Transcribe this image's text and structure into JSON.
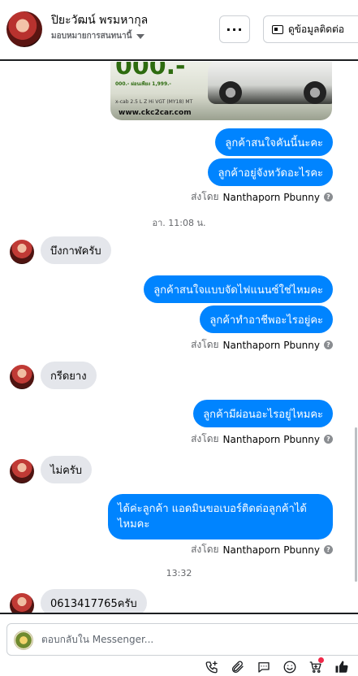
{
  "header": {
    "name": "ปิยะวัฒน์ พรมหากุล",
    "subtitle": "มอบหมายการสนทนานี้",
    "more_label": "···",
    "contact_label": "ดูข้อมูลติดต่อ"
  },
  "ad_image": {
    "headline": "000.-",
    "detail": "000.- ผ่อนเพียง 1,999.-",
    "model": "x-cab 2.5 L Z Hi VGT (MY18) MT",
    "url": "www.ckc2car.com"
  },
  "messages": {
    "out1": "ลูกค้าสนใจคันนี้นะคะ",
    "out2": "ลูกค้าอยู่จังหวัดอะไรคะ",
    "time1": "อา. 11:08 น.",
    "in1": "บึงกาฬครับ",
    "out3": "ลูกค้าสนใจแบบจัดไฟแนนซ์ใช่ไหมคะ",
    "out4": "ลูกค้าทำอาชีพอะไรอยู่คะ",
    "in2": "กรีดยาง",
    "out5": "ลูกค้ามีผ่อนอะไรอยู่ไหมคะ",
    "in3": "ไม่ครับ",
    "out6": "ได้ค่ะลูกค้า แอดมินขอเบอร์ติดต่อลูกค้าได้ไหมคะ",
    "time2": "13:32",
    "in4": "0613417765ครับ"
  },
  "sent_by": {
    "prefix": "ส่งโดย",
    "sender": "Nanthaporn Pbunny",
    "info": "?"
  },
  "composer": {
    "placeholder": "ตอบกลับใน Messenger..."
  },
  "colors": {
    "outgoing_bubble": "#0084ff",
    "incoming_bubble": "#e4e6eb",
    "toolbar_icon": "#1c1e21",
    "notification_dot": "#f02849"
  },
  "toolbar_icons": [
    "phone-plus-icon",
    "attachment-icon",
    "saved-replies-icon",
    "emoji-icon",
    "cart-icon",
    "like-icon"
  ]
}
